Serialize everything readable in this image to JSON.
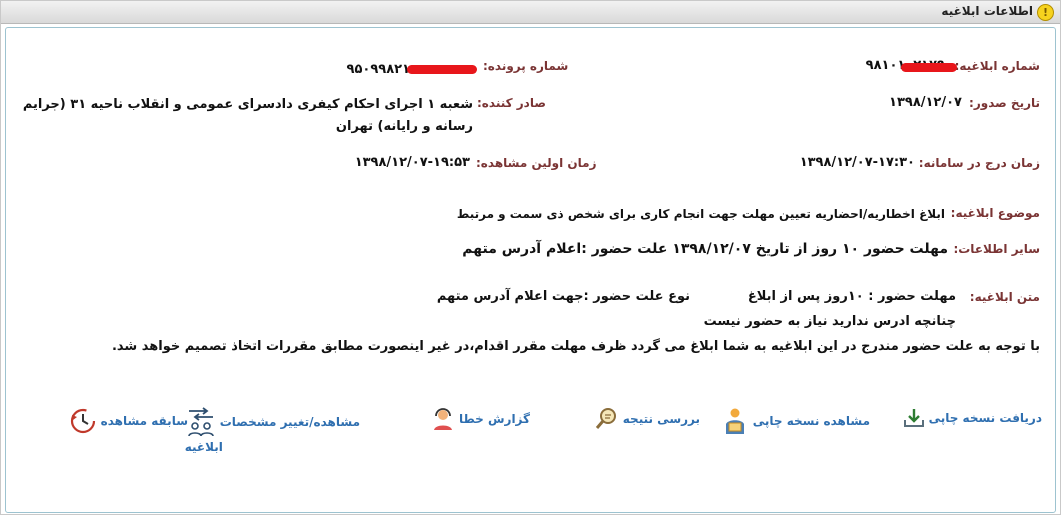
{
  "window": {
    "title": "اطلاعات ابلاغیه"
  },
  "fields": {
    "notice_number_label": "شماره ابلاغیه:",
    "notice_number_value": "۹۸۱۰۱۰۲۱۷۹",
    "case_number_label": "شماره پرونده:",
    "case_number_value": "۹۵۰۹۹۸۲۱",
    "issue_date_label": "تاریخ صدور:",
    "issue_date_value": "۱۳۹۸/۱۲/۰۷",
    "issuer_label": "صادر کننده:",
    "issuer_value": "شعبه ۱ اجرای احکام کیفری دادسرای عمومی و انقلاب ناحیه ۳۱ (جرایم رسانه و رایانه) تهران",
    "system_entry_label": "زمان درج در سامانه:",
    "system_entry_value": "۱۳۹۸/۱۲/۰۷-۱۷:۳۰",
    "first_view_label": "زمان اولین مشاهده:",
    "first_view_value": "۱۳۹۸/۱۲/۰۷-۱۹:۵۳",
    "subject_label": "موضوع ابلاغیه:",
    "subject_value": "ابلاغ اخطاریه/احضاریه تعیین مهلت جهت انجام کاری برای شخص ذی سمت و مرتبط",
    "other_info_label": "سایر اطلاعات:",
    "other_info_value": "مهلت حضور ۱۰ روز از تاریخ ۱۳۹۸/۱۲/۰۷ علت حضور :اعلام آدرس متهم",
    "text_label": "متن ابلاغیه:",
    "text_line1_a": "مهلت حضور : ۱۰روز  پس از ابلاغ",
    "text_line1_b": "نوع علت حضور :جهت  اعلام آدرس متهم",
    "text_line2": "چنانچه ادرس ندارید نیاز به حضور نیست",
    "text_line3": "با توجه به علت حضور مندرج در این ابلاغیه به شما ابلاغ می گردد ظرف مهلت مقرر اقدام،در غیر اینصورت مطابق مقررات اتخاذ تصمیم خواهد شد."
  },
  "actions": {
    "receive_print": "دریافت نسخه چاپی",
    "view_print": "مشاهده نسخه چاپی",
    "review_result": "بررسی نتیجه",
    "report_error": "گزارش خطا",
    "view_change_line1": "مشاهده/تغییر مشخصات",
    "view_change_line2": "ابلاغیه",
    "view_history": "سابقه مشاهده"
  },
  "colors": {
    "label": "#7a3434",
    "link": "#2f6fb0",
    "redaction": "#e8161b",
    "panel_border": "#9dc3d0"
  }
}
